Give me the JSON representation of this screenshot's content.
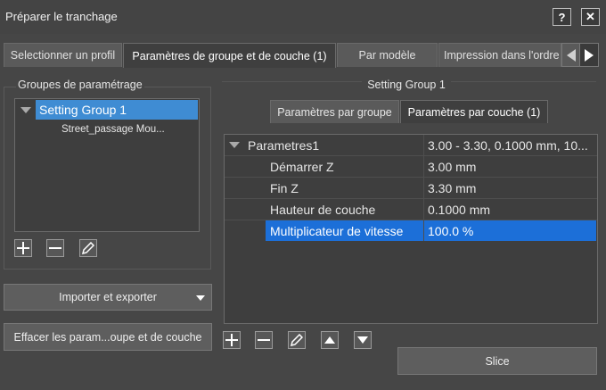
{
  "window": {
    "title": "Préparer le tranchage",
    "help_label": "?",
    "close_label": "✕"
  },
  "tabs": [
    {
      "label": "Selectionner un profil",
      "active": false
    },
    {
      "label": "Paramètres de groupe et de couche (1)",
      "active": true
    },
    {
      "label": "Par modèle",
      "active": false
    },
    {
      "label": "Impression dans l'ordre",
      "active": false
    }
  ],
  "left": {
    "group_title": "Groupes de paramétrage",
    "tree": [
      {
        "label": "Setting Group 1",
        "selected": true
      },
      {
        "label": "Street_passage Mou...",
        "selected": false
      }
    ],
    "import_export_label": "Importer et exporter",
    "clear_label": "Effacer les param...oupe et de couche"
  },
  "right": {
    "setting_title": "Setting Group 1",
    "subtabs": [
      {
        "label": "Paramètres par groupe",
        "active": false
      },
      {
        "label": "Paramètres par couche (1)",
        "active": true
      }
    ],
    "rows": [
      {
        "name": "Parametres1",
        "value": "3.00 - 3.30, 0.1000 mm, 10...",
        "selected": false
      },
      {
        "name": "Démarrer Z",
        "value": "3.00 mm",
        "selected": false
      },
      {
        "name": "Fin Z",
        "value": "3.30 mm",
        "selected": false
      },
      {
        "name": "Hauteur de couche",
        "value": "0.1000 mm",
        "selected": false
      },
      {
        "name": "Multiplicateur de vitesse",
        "value": "100.0 %",
        "selected": true
      }
    ],
    "slice_label": "Slice"
  },
  "colors": {
    "selection": "#3f8cd3",
    "row_selection": "#1c6fd8"
  }
}
